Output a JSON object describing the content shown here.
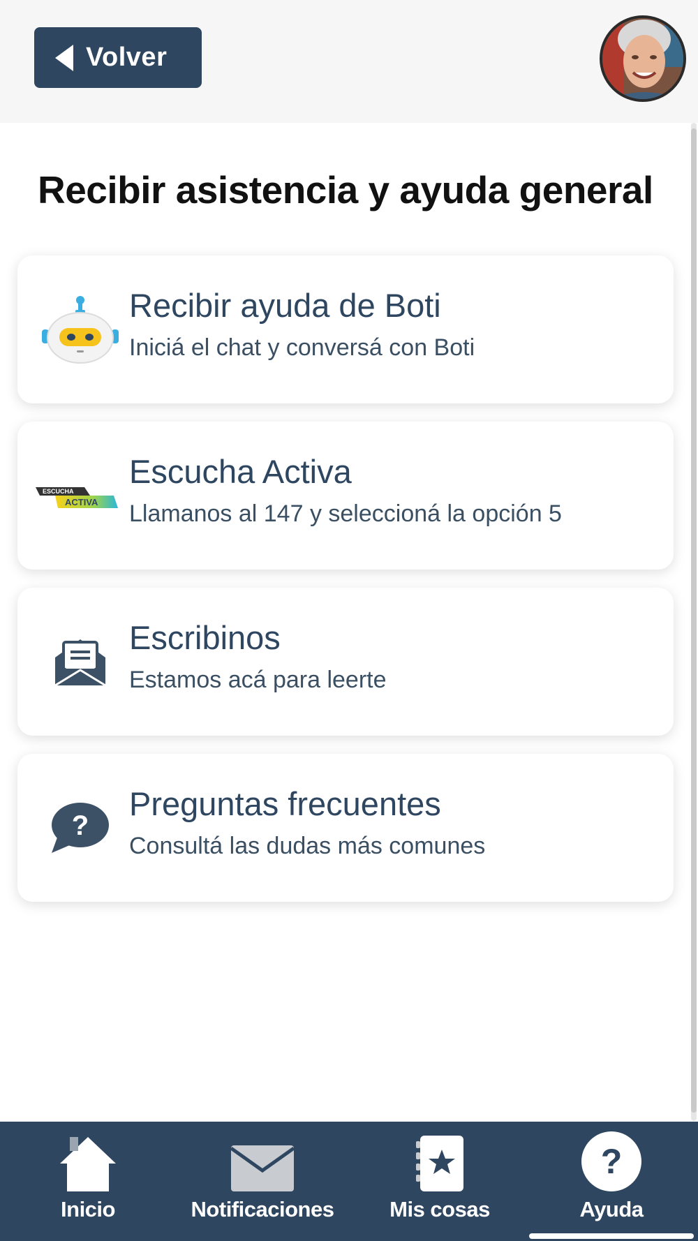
{
  "header": {
    "back_label": "Volver",
    "avatar_alt": "avatar"
  },
  "page": {
    "title": "Recibir asistencia y ayuda general"
  },
  "options": [
    {
      "title": "Recibir ayuda de Boti",
      "subtitle": "Iniciá el chat y conversá con Boti",
      "icon": "robot-icon"
    },
    {
      "title": "Escucha Activa",
      "subtitle": "Llamanos al 147 y seleccioná la opción 5",
      "icon": "escucha-activa-logo",
      "logo_text_top": "ESCUCHA",
      "logo_text_bottom": "ACTIVA"
    },
    {
      "title": "Escribinos",
      "subtitle": "Estamos acá para leerte",
      "icon": "envelope-open-icon"
    },
    {
      "title": "Preguntas frecuentes",
      "subtitle": "Consultá las dudas más comunes",
      "icon": "question-bubble-icon"
    }
  ],
  "bottom_nav": {
    "items": [
      {
        "label": "Inicio",
        "icon": "home-icon"
      },
      {
        "label": "Notificaciones",
        "icon": "mail-icon"
      },
      {
        "label": "Mis cosas",
        "icon": "star-book-icon"
      },
      {
        "label": "Ayuda",
        "icon": "help-circle-icon",
        "active": true
      }
    ]
  },
  "colors": {
    "primary": "#2e4660",
    "background": "#ffffff",
    "header_bg": "#f6f6f6"
  }
}
